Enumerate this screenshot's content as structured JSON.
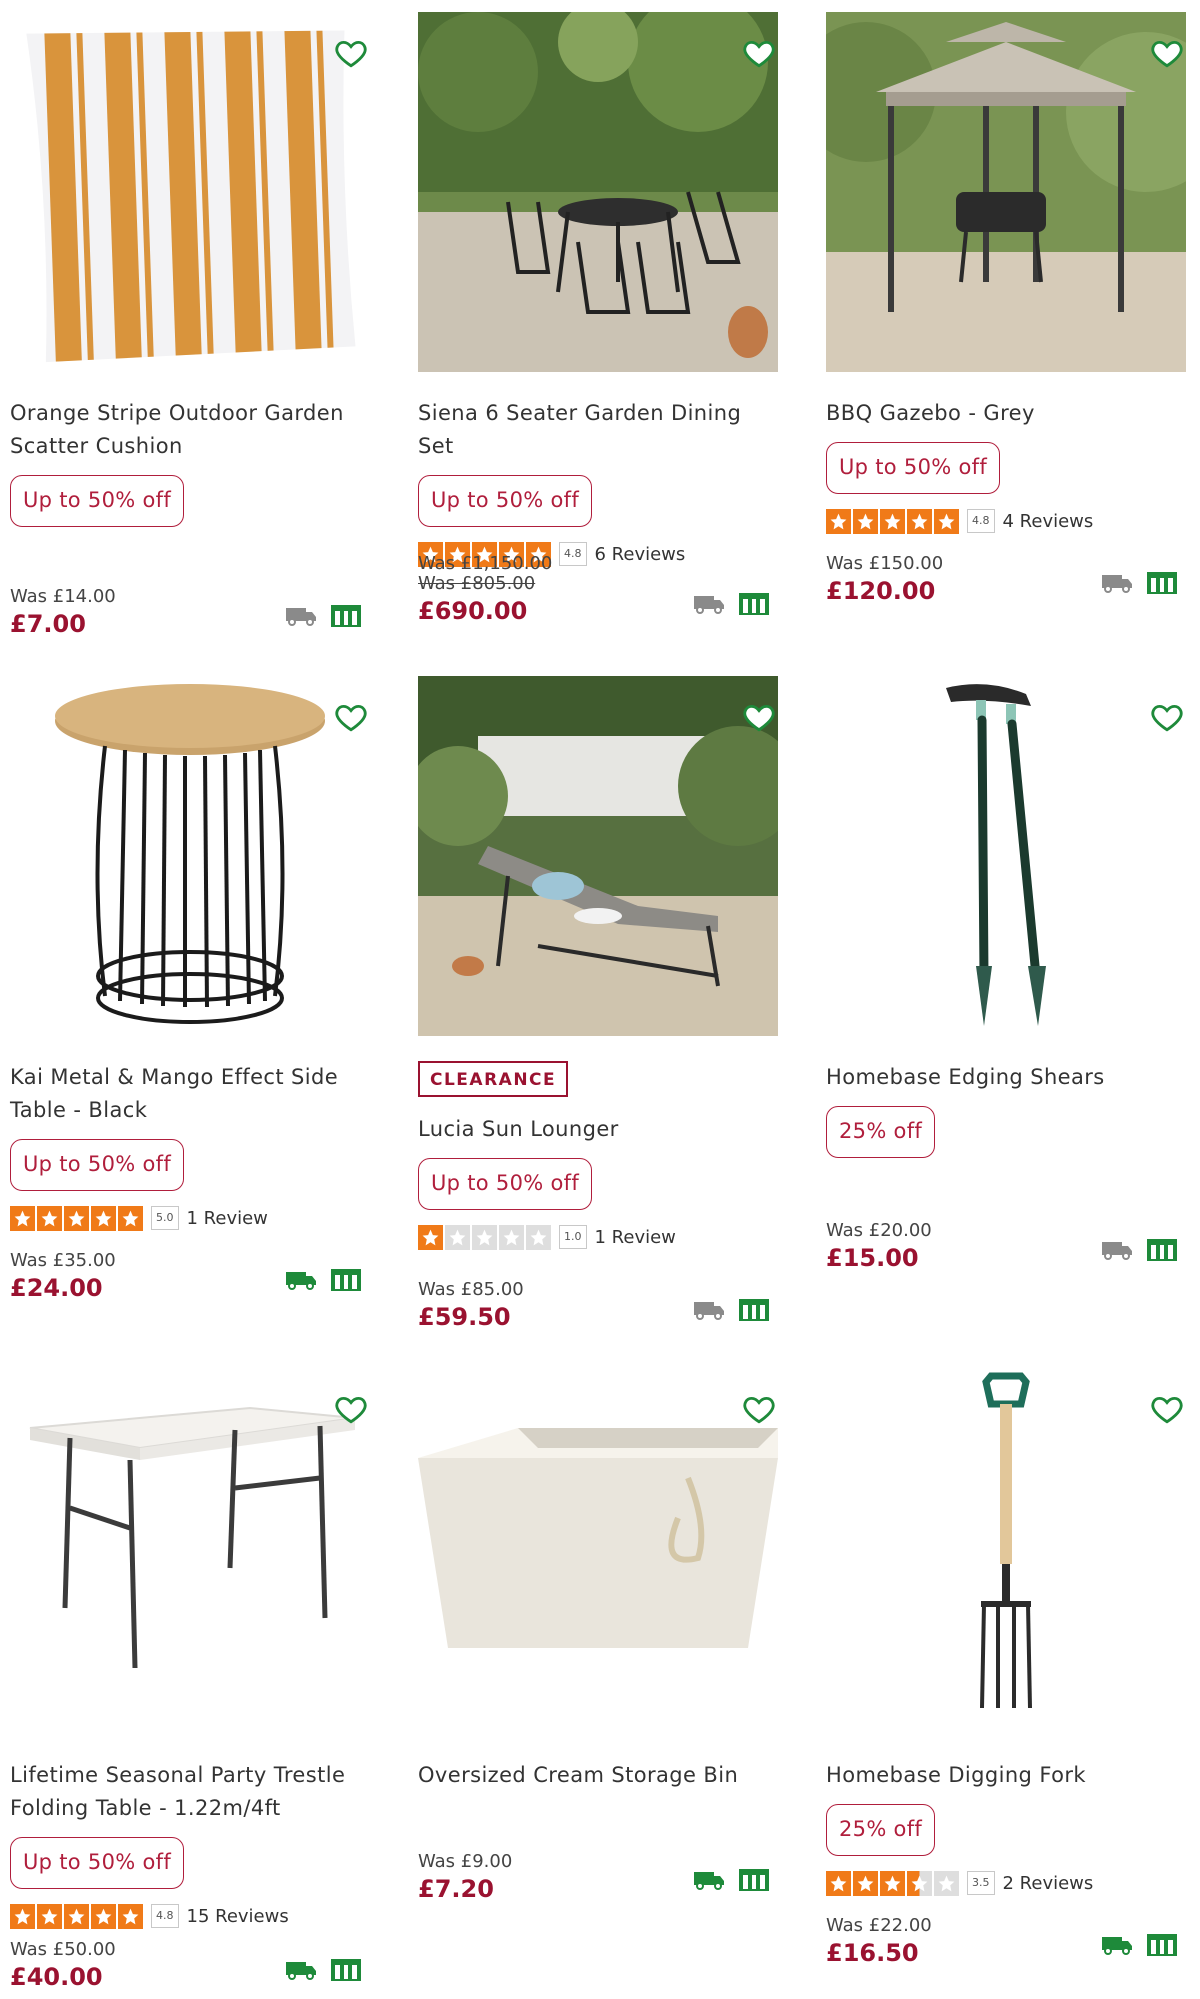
{
  "colors": {
    "brand": "#9a1230",
    "badge": "#b01e3c",
    "star": "#f07a18",
    "stock_green": "#1e8a3a",
    "wish_green": "#1e8a3a",
    "grey_icon": "#8a8a8a"
  },
  "icons": {
    "wishlist": "heart-outline-icon",
    "delivery": "delivery-truck-icon",
    "collection": "store-collect-icon"
  },
  "products": [
    {
      "title": "Orange Stripe Outdoor Garden Scatter Cushion",
      "badge": "Up to 50% off",
      "was": "Was £14.00",
      "price": "£7.00",
      "delivery_available": false
    },
    {
      "title": "Siena 6 Seater Garden Dining Set",
      "badge": "Up to 50% off",
      "rating": 4.8,
      "score": "4.8",
      "reviews": "6 Reviews",
      "was": "Was £1,150.00",
      "was2": "Was £805.00",
      "price": "£690.00",
      "delivery_available": false
    },
    {
      "title": "BBQ Gazebo - Grey",
      "badge": "Up to 50% off",
      "rating": 4.8,
      "score": "4.8",
      "reviews": "4 Reviews",
      "was": "Was £150.00",
      "price": "£120.00",
      "delivery_available": false
    },
    {
      "title": "Kai Metal & Mango Effect Side Table - Black",
      "badge": "Up to 50% off",
      "rating": 5.0,
      "score": "5.0",
      "reviews": "1 Review",
      "was": "Was £35.00",
      "price": "£24.00",
      "delivery_available": true
    },
    {
      "clearance": "CLEARANCE",
      "title": "Lucia Sun Lounger",
      "badge": "Up to 50% off",
      "rating": 1.0,
      "score": "1.0",
      "reviews": "1 Review",
      "was": "Was £85.00",
      "price": "£59.50",
      "delivery_available": false
    },
    {
      "title": "Homebase Edging Shears",
      "badge": "25% off",
      "was": "Was £20.00",
      "price": "£15.00",
      "delivery_available": false
    },
    {
      "title": "Lifetime Seasonal Party Trestle Folding Table - 1.22m/4ft",
      "badge": "Up to 50% off",
      "rating": 4.8,
      "score": "4.8",
      "reviews": "15 Reviews",
      "was": "Was £50.00",
      "price": "£40.00",
      "delivery_available": true
    },
    {
      "title": "Oversized Cream Storage Bin",
      "was": "Was £9.00",
      "price": "£7.20",
      "delivery_available": true
    },
    {
      "title": "Homebase Digging Fork",
      "badge": "25% off",
      "rating": 3.5,
      "score": "3.5",
      "reviews": "2 Reviews",
      "was": "Was £22.00",
      "price": "£16.50",
      "delivery_available": true
    }
  ]
}
